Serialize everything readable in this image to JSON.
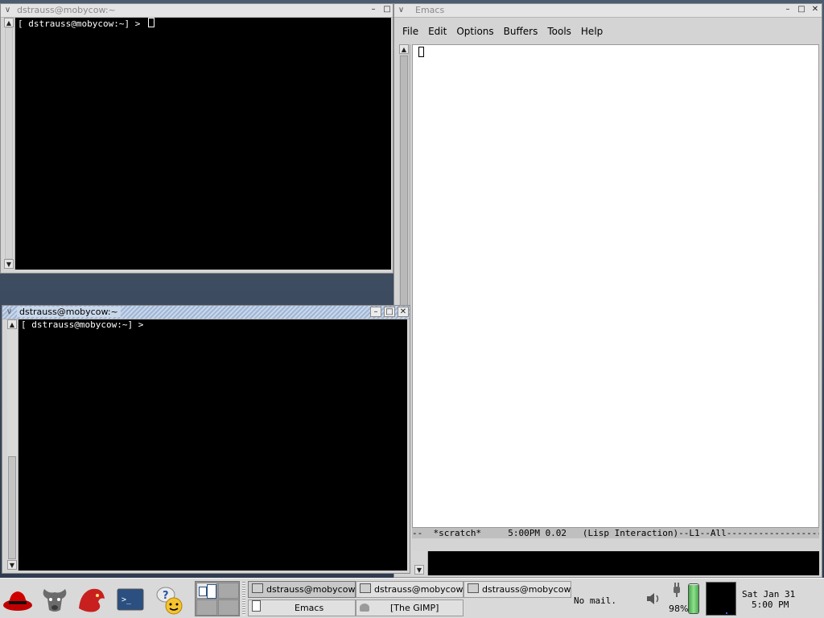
{
  "terminal_top": {
    "title": "dstrauss@mobycow:~",
    "prompt": "[ dstrauss@mobycow:~] > "
  },
  "terminal_bottom": {
    "title": "dstrauss@mobycow:~",
    "prompt": "[ dstrauss@mobycow:~] > "
  },
  "emacs": {
    "title": "Emacs",
    "menu": [
      "File",
      "Edit",
      "Options",
      "Buffers",
      "Tools",
      "Help"
    ],
    "modeline": "--  *scratch*     5:00PM 0.02   (Lisp Interaction)--L1--All----------------------------------"
  },
  "panel": {
    "launchers": [
      "redhat-menu-icon",
      "gnome-foot-icon",
      "mozilla-icon",
      "terminal-icon",
      "help-icon"
    ],
    "tasks": [
      {
        "label": "dstrauss@mobycow:~",
        "icon": "terminal-icon",
        "pressed": true
      },
      {
        "label": "dstrauss@mobycow:~",
        "icon": "terminal-icon",
        "pressed": false
      },
      {
        "label": "dstrauss@mobycow:~",
        "icon": "terminal-icon",
        "pressed": false
      },
      {
        "label": "Emacs",
        "icon": "document-icon",
        "pressed": false
      },
      {
        "label": "[The GIMP]",
        "icon": "gimp-icon",
        "pressed": false
      }
    ],
    "mail_status": "No mail.",
    "battery_percent": "98%",
    "battery_level": 0.98,
    "clock_date": "Sat Jan 31",
    "clock_time": "5:00 PM"
  }
}
